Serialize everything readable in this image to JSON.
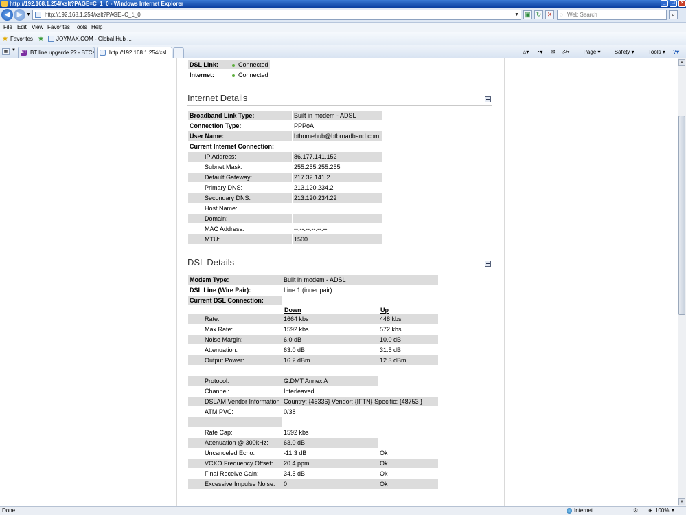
{
  "window": {
    "title": "http://192.168.1.254/xslt?PAGE=C_1_0 - Windows Internet Explorer",
    "address": "http://192.168.1.254/xslt?PAGE=C_1_0",
    "search_placeholder": "Web Search"
  },
  "menu": [
    "File",
    "Edit",
    "View",
    "Favorites",
    "Tools",
    "Help"
  ],
  "favorites": {
    "label": "Favorites",
    "link": "JOYMAX.COM - Global Hub ..."
  },
  "tabs": [
    {
      "label": "BT line upgarde ?? - BTCare ...",
      "icon": "bt-icon"
    },
    {
      "label": "http://192.168.1.254/xsl...",
      "icon": "page-icon"
    }
  ],
  "commands": {
    "page": "Page",
    "safety": "Safety",
    "tools": "Tools"
  },
  "status": {
    "left": "Done",
    "zone": "Internet",
    "zoom": "100%"
  },
  "link_status": {
    "dsl_link_label": "DSL Link:",
    "dsl_link_value": "Connected",
    "internet_label": "Internet:",
    "internet_value": "Connected"
  },
  "internet_details": {
    "heading": "Internet Details",
    "rows": [
      {
        "label": "Broadband Link Type:",
        "value": "Built in modem - ADSL",
        "bold": true,
        "shade": true
      },
      {
        "label": "Connection Type:",
        "value": "PPPoA",
        "bold": true,
        "shade": false
      },
      {
        "label": "User Name:",
        "value": "bthomehub@btbroadband.com",
        "bold": true,
        "shade": true
      },
      {
        "label": "Current Internet Connection:",
        "value": "",
        "bold": true,
        "shade": false
      },
      {
        "label": "IP Address:",
        "value": "86.177.141.152",
        "indent": true,
        "shade": true
      },
      {
        "label": "Subnet Mask:",
        "value": "255.255.255.255",
        "indent": true,
        "shade": false
      },
      {
        "label": "Default Gateway:",
        "value": "217.32.141.2",
        "indent": true,
        "shade": true
      },
      {
        "label": "Primary DNS:",
        "value": "213.120.234.2",
        "indent": true,
        "shade": false
      },
      {
        "label": "Secondary DNS:",
        "value": "213.120.234.22",
        "indent": true,
        "shade": true
      },
      {
        "label": "Host Name:",
        "value": "",
        "indent": true,
        "shade": false
      },
      {
        "label": "Domain:",
        "value": "",
        "indent": true,
        "shade": true
      },
      {
        "label": "MAC Address:",
        "value": "--:--:--:--:--:--",
        "indent": true,
        "shade": false
      },
      {
        "label": "MTU:",
        "value": "1500",
        "indent": true,
        "shade": true
      }
    ]
  },
  "dsl_details": {
    "heading": "DSL Details",
    "top_rows": [
      {
        "label": "Modem Type:",
        "value": "Built in modem - ADSL",
        "shade": true
      },
      {
        "label": "DSL Line (Wire Pair):",
        "value": "Line 1 (inner pair)",
        "shade": false
      },
      {
        "label": "Current DSL Connection:",
        "value": "",
        "shade": true
      }
    ],
    "col_down": "Down",
    "col_up": "Up",
    "rate_rows": [
      {
        "label": "Rate:",
        "down": "1664 kbs",
        "up": "448 kbs",
        "shade": true
      },
      {
        "label": "Max Rate:",
        "down": "1592 kbs",
        "up": "572 kbs",
        "shade": false
      },
      {
        "label": "Noise Margin:",
        "down": "6.0 dB",
        "up": "10.0 dB",
        "shade": true
      },
      {
        "label": "Attenuation:",
        "down": "63.0 dB",
        "up": "31.5 dB",
        "shade": false
      },
      {
        "label": "Output Power:",
        "down": "16.2 dBm",
        "up": "12.3 dBm",
        "shade": true
      }
    ],
    "proto_rows": [
      {
        "label": "Protocol:",
        "value": "G.DMT Annex A",
        "shade": true
      },
      {
        "label": "Channel:",
        "value": "Interleaved",
        "shade": false
      },
      {
        "label": "DSLAM Vendor Information",
        "value": "Country: {46336} Vendor: {IFTN} Specific: {48753 }",
        "shade": true,
        "wide": true
      },
      {
        "label": "ATM PVC:",
        "value": "0/38",
        "shade": false
      },
      {
        "label": "",
        "value": "",
        "shade": true
      }
    ],
    "diag_rows": [
      {
        "label": "Rate Cap:",
        "value": "1592 kbs",
        "status": "",
        "shade": false
      },
      {
        "label": "Attenuation @ 300kHz:",
        "value": "63.0 dB",
        "status": "",
        "shade": true
      },
      {
        "label": "Uncanceled Echo:",
        "value": "-11.3 dB",
        "status": "Ok",
        "shade": false
      },
      {
        "label": "VCXO Frequency Offset:",
        "value": "20.4 ppm",
        "status": "Ok",
        "shade": true
      },
      {
        "label": "Final Receive Gain:",
        "value": "34.5 dB",
        "status": "Ok",
        "shade": false
      },
      {
        "label": "Excessive Impulse Noise:",
        "value": "0",
        "status": "Ok",
        "shade": true
      }
    ]
  }
}
